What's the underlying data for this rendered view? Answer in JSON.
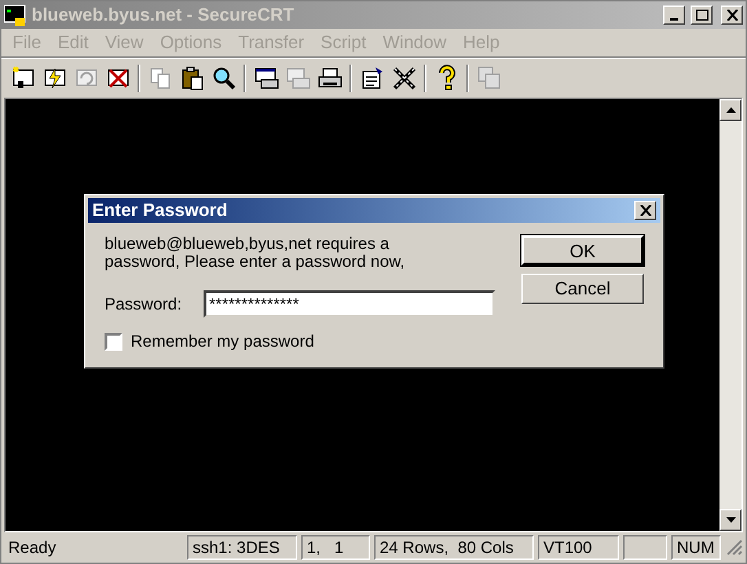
{
  "window": {
    "title": "blueweb.byus.net - SecureCRT",
    "active": false
  },
  "menu": [
    {
      "label": "File",
      "disabled": true
    },
    {
      "label": "Edit",
      "disabled": true
    },
    {
      "label": "View",
      "disabled": true
    },
    {
      "label": "Options",
      "disabled": true
    },
    {
      "label": "Transfer",
      "disabled": true
    },
    {
      "label": "Script",
      "disabled": true
    },
    {
      "label": "Window",
      "disabled": true
    },
    {
      "label": "Help",
      "disabled": true
    }
  ],
  "toolbar": [
    {
      "kind": "connect",
      "disabled": false
    },
    {
      "kind": "quick-connect",
      "disabled": false
    },
    {
      "kind": "reconnect",
      "disabled": true
    },
    {
      "kind": "disconnect",
      "disabled": false
    },
    {
      "kind": "sep"
    },
    {
      "kind": "copy",
      "disabled": true
    },
    {
      "kind": "paste",
      "disabled": false
    },
    {
      "kind": "find",
      "disabled": false
    },
    {
      "kind": "sep"
    },
    {
      "kind": "print-screen",
      "disabled": false
    },
    {
      "kind": "print-selection",
      "disabled": true
    },
    {
      "kind": "print",
      "disabled": false
    },
    {
      "kind": "sep"
    },
    {
      "kind": "properties",
      "disabled": false
    },
    {
      "kind": "tools",
      "disabled": false
    },
    {
      "kind": "sep"
    },
    {
      "kind": "help",
      "disabled": false
    },
    {
      "kind": "sep"
    },
    {
      "kind": "multi",
      "disabled": true
    }
  ],
  "dialog": {
    "title": "Enter Password",
    "message": "blueweb@blueweb,byus,net requires a password,  Please enter a password now,",
    "password_label": "Password:",
    "password_value": "**************",
    "remember": {
      "label": "Remember my password",
      "checked": false
    },
    "buttons": [
      "OK",
      "Cancel"
    ]
  },
  "status_bar": [
    "Ready",
    "ssh1: 3DES",
    "1,   1",
    "24 Rows,  80 Cols",
    "VT100",
    "NUM"
  ]
}
